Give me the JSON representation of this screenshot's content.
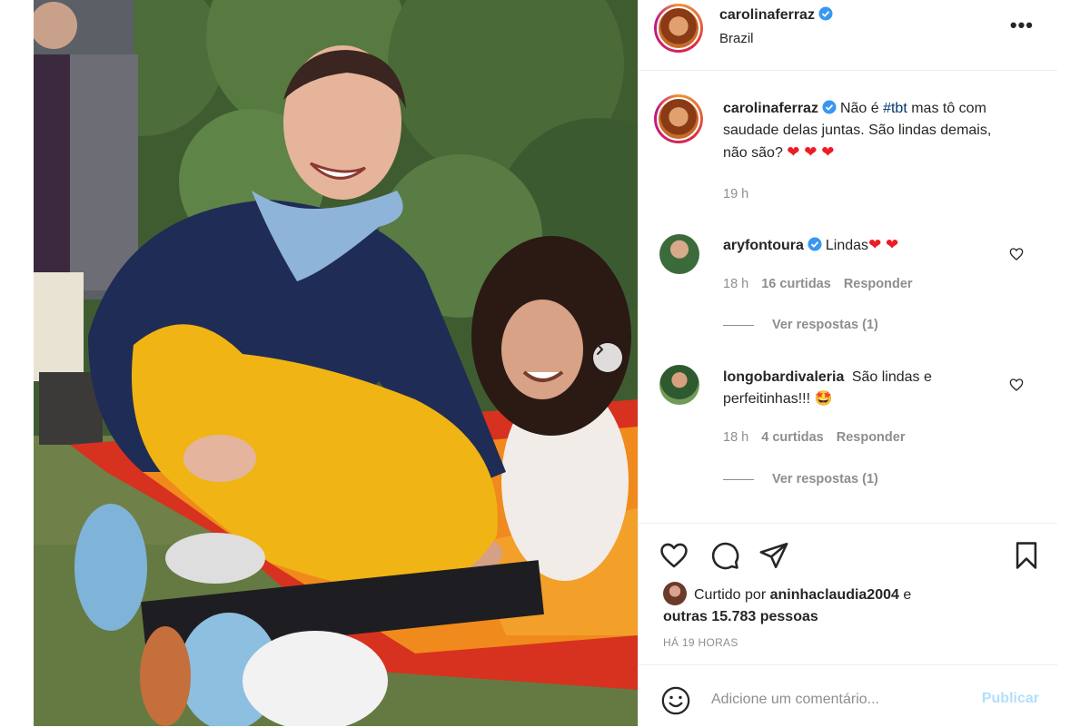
{
  "header": {
    "username": "carolinaferraz",
    "location": "Brazil",
    "more_label": "•••"
  },
  "caption": {
    "username": "carolinaferraz",
    "text_before": "Não é ",
    "hashtag": "#tbt",
    "text_after": " mas tô com saudade delas juntas. São lindas demais, não são?",
    "emojis": "❤ ❤ ❤",
    "time": "19 h"
  },
  "comments": [
    {
      "username": "aryfontoura",
      "verified": true,
      "text": "Lindas",
      "emojis": "❤ ❤",
      "time": "18 h",
      "likes": "16 curtidas",
      "reply_label": "Responder",
      "view_replies": "Ver respostas (1)"
    },
    {
      "username": "longobardivaleria",
      "verified": false,
      "text": "São lindas e perfeitinhas!!!",
      "emojis": "🤩",
      "time": "18 h",
      "likes": "4 curtidas",
      "reply_label": "Responder",
      "view_replies": "Ver respostas (1)"
    }
  ],
  "actions": {
    "liked_by_prefix": "Curtido por",
    "liked_by_user": "aninhaclaudia2004",
    "liked_by_joiner": "e",
    "liked_by_others": "outras 15.783 pessoas",
    "time_ago": "HÁ 19 HORAS"
  },
  "add_comment": {
    "placeholder": "Adicione um comentário...",
    "publish_label": "Publicar"
  },
  "icons": {
    "verified": "verified-badge-icon",
    "like": "heart-icon",
    "comment": "comment-icon",
    "share": "paper-plane-icon",
    "save": "bookmark-icon",
    "emoji": "smiley-icon",
    "next": "chevron-right-icon",
    "more": "more-horizontal-icon"
  },
  "colors": {
    "verified_blue": "#3897f0",
    "text": "#262626",
    "muted": "#8e8e8e",
    "publish_disabled": "#b2dffc",
    "hashtag": "#00376b"
  }
}
